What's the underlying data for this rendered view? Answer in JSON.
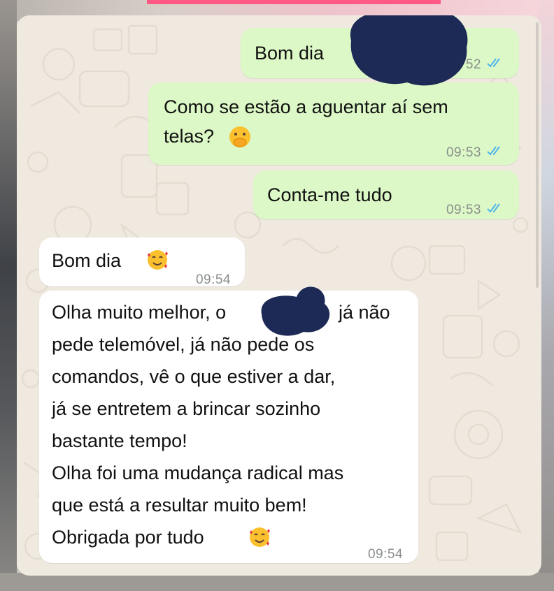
{
  "chat": {
    "messages": [
      {
        "direction": "outgoing",
        "text": "Bom dia",
        "time": "52",
        "status": "read"
      },
      {
        "direction": "outgoing",
        "lines": [
          "Como se estão a aguentar aí sem",
          "telas?"
        ],
        "time": "09:53",
        "status": "read"
      },
      {
        "direction": "outgoing",
        "text": "Conta-me tudo",
        "time": "09:53",
        "status": "read"
      },
      {
        "direction": "incoming",
        "text": "Bom dia",
        "time": "09:54"
      },
      {
        "direction": "incoming",
        "lines": [
          "Olha muito melhor, o",
          "já não",
          "pede telemóvel, já não pede os",
          "comandos, vê o que estiver a dar,",
          "já se entretem a brincar sozinho",
          "bastante tempo!",
          "Olha foi uma mudança radical mas",
          "que está a resultar muito bem!",
          "Obrigada por tudo"
        ],
        "time": "09:54"
      }
    ]
  },
  "icons": {
    "read_receipt": "double-check-icon",
    "emoji_1": "hand-over-mouth-emoji",
    "emoji_2": "smiling-face-with-hearts-emoji"
  },
  "colors": {
    "outgoing_bubble": "#dcf8c6",
    "incoming_bubble": "#ffffff",
    "chat_background": "#efe9e0",
    "read_tick": "#4fb6ec",
    "redaction": "#1c2a55",
    "timestamp": "#8a8f8c"
  }
}
